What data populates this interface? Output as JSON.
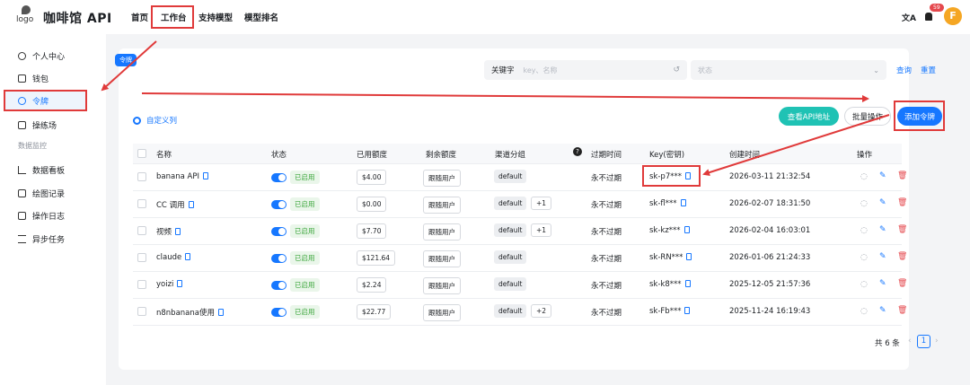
{
  "topbar": {
    "logo_text": "logo",
    "title": "咖啡馆 API",
    "nav": [
      "首页",
      "工作台",
      "支持模型",
      "模型排名"
    ],
    "translate_icon": "translate-icon",
    "notification_count": "59",
    "avatar_letter": "F"
  },
  "tooltip": "令牌",
  "sidebar": {
    "items": [
      {
        "label": "个人中心",
        "icon": "user-icon"
      },
      {
        "label": "钱包",
        "icon": "wallet-icon"
      },
      {
        "label": "令牌",
        "icon": "key-icon",
        "active": true
      },
      {
        "label": "操练场",
        "icon": "playground-icon"
      }
    ],
    "group_label": "数据监控",
    "group_items": [
      {
        "label": "数据看板",
        "icon": "chart-icon"
      },
      {
        "label": "绘图记录",
        "icon": "image-icon"
      },
      {
        "label": "操作日志",
        "icon": "log-icon"
      },
      {
        "label": "异步任务",
        "icon": "task-icon"
      }
    ]
  },
  "filters": {
    "keyword_label": "关键字",
    "keyword_placeholder": "key、名称",
    "status_placeholder": "状态",
    "query_label": "查询",
    "reset_label": "重置"
  },
  "toolbar": {
    "custom_columns": "自定义列",
    "view_api": "查看API地址",
    "batch": "批量操作",
    "add_token": "添加令牌"
  },
  "table": {
    "headers": [
      "名称",
      "状态",
      "已用额度",
      "剩余额度",
      "渠道分组",
      "过期时间",
      "Key(密钥)",
      "创建时间",
      "操作"
    ],
    "rows": [
      {
        "name": "banana API",
        "status": "已启用",
        "used": "$4.00",
        "remaining": "跟随用户",
        "group": "default",
        "extra": "",
        "expire": "永不过期",
        "key": "sk-p7***",
        "created": "2026-03-11 21:32:54"
      },
      {
        "name": "CC 调用",
        "status": "已启用",
        "used": "$0.00",
        "remaining": "跟随用户",
        "group": "default",
        "extra": "+1",
        "expire": "永不过期",
        "key": "sk-fl***",
        "created": "2026-02-07 18:31:50"
      },
      {
        "name": "视频",
        "status": "已启用",
        "used": "$7.70",
        "remaining": "跟随用户",
        "group": "default",
        "extra": "+1",
        "expire": "永不过期",
        "key": "sk-kz***",
        "created": "2026-02-04 16:03:01"
      },
      {
        "name": "claude",
        "status": "已启用",
        "used": "$121.64",
        "remaining": "跟随用户",
        "group": "default",
        "extra": "",
        "expire": "永不过期",
        "key": "sk-RN***",
        "created": "2026-01-06 21:24:33"
      },
      {
        "name": "yoizi",
        "status": "已启用",
        "used": "$2.24",
        "remaining": "跟随用户",
        "group": "default",
        "extra": "",
        "expire": "永不过期",
        "key": "sk-k8***",
        "created": "2025-12-05 21:57:36"
      },
      {
        "name": "n8nbanana使用",
        "status": "已启用",
        "used": "$22.77",
        "remaining": "跟随用户",
        "group": "default",
        "extra": "+2",
        "expire": "永不过期",
        "key": "sk-Fb***",
        "created": "2025-11-24 16:19:43"
      }
    ]
  },
  "pagination": {
    "total": "共 6 条",
    "current": "1"
  },
  "colors": {
    "accent": "#1677ff",
    "highlight": "#e03a3a",
    "teal": "#1fc2b4"
  }
}
